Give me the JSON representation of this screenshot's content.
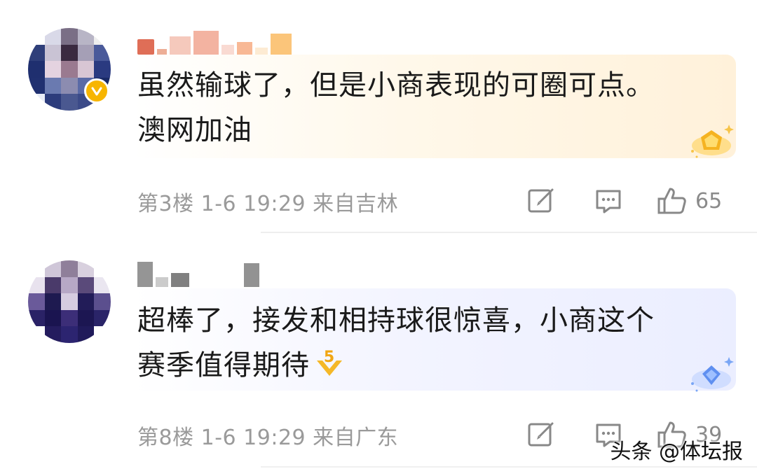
{
  "comments": [
    {
      "text_line1": "虽然输球了，但是小商表现的可圈可点。",
      "text_line2": "澳网加油",
      "meta": "第3楼 1-6 19:29 来自吉林",
      "likes": "65",
      "bubble_color": "#fff1da",
      "verified": true
    },
    {
      "text_line1": "超棒了，接发和相持球很惊喜，小商这个",
      "text_line2": "赛季值得期待",
      "meta": "第8楼 1-6 19:29 来自广东",
      "likes": "39",
      "bubble_color": "#ebeeff",
      "verified": false
    }
  ],
  "icons": {
    "edit": "edit-icon",
    "reply": "comment-icon",
    "like": "thumbs-up-icon",
    "verified": "verified-v-icon",
    "badge": "medal-icon"
  },
  "watermark": "头条 @体坛报"
}
